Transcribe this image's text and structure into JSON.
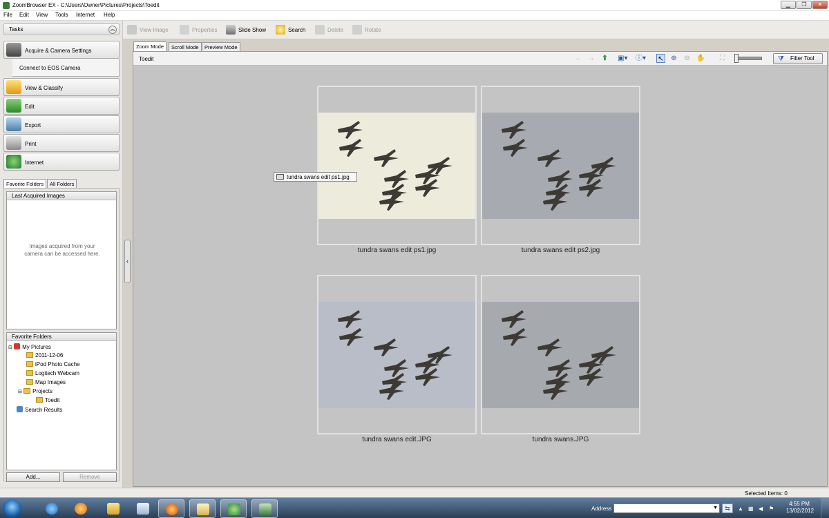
{
  "window": {
    "title": "ZoomBrowser EX - C:\\Users\\Owner\\Pictures\\Projects\\Toedit"
  },
  "menu": [
    "File",
    "Edit",
    "View",
    "Tools",
    "Internet",
    "Help"
  ],
  "tasks": {
    "header": "Tasks",
    "items": [
      "Acquire & Camera Settings",
      "View & Classify",
      "Edit",
      "Export",
      "Print",
      "Internet"
    ],
    "sub_item": "Connect to EOS Camera"
  },
  "folder_tabs": [
    "Favorite Folders",
    "All Folders"
  ],
  "last_acquired": {
    "header": "Last Acquired Images",
    "message_line1": "Images acquired from your",
    "message_line2": "camera can be accessed here."
  },
  "favorite_folders": {
    "header": "Favorite Folders",
    "tree": [
      "My Pictures",
      "2011-12-06",
      "iPod Photo Cache",
      "Logitech Webcam",
      "Map Images",
      "Projects",
      "Toedit",
      "Search Results"
    ],
    "add_label": "Add...",
    "remove_label": "Remove"
  },
  "toolbar": {
    "view_image": "View Image",
    "properties": "Properties",
    "slide_show": "Slide Show",
    "search": "Search",
    "delete": "Delete",
    "rotate": "Rotate"
  },
  "mode_tabs": [
    "Zoom Mode",
    "Scroll Mode",
    "Preview Mode"
  ],
  "viewer": {
    "folder": "Toedit",
    "filter_tool": "Filter Tool",
    "tooltip": "tundra swans edit ps1.jpg",
    "images": [
      {
        "caption": "tundra swans edit ps1.jpg",
        "bg": "#ecebdc"
      },
      {
        "caption": "tundra swans edit ps2.jpg",
        "bg": "#a7aab1"
      },
      {
        "caption": "tundra swans edit.JPG",
        "bg": "#b8bdc8"
      },
      {
        "caption": "tundra swans.JPG",
        "bg": "#a6a9ae"
      }
    ]
  },
  "status": {
    "selected_items": "Selected Items: 0"
  },
  "taskbar": {
    "address_label": "Address",
    "time": "4:55 PM",
    "date": "13/02/2012"
  }
}
